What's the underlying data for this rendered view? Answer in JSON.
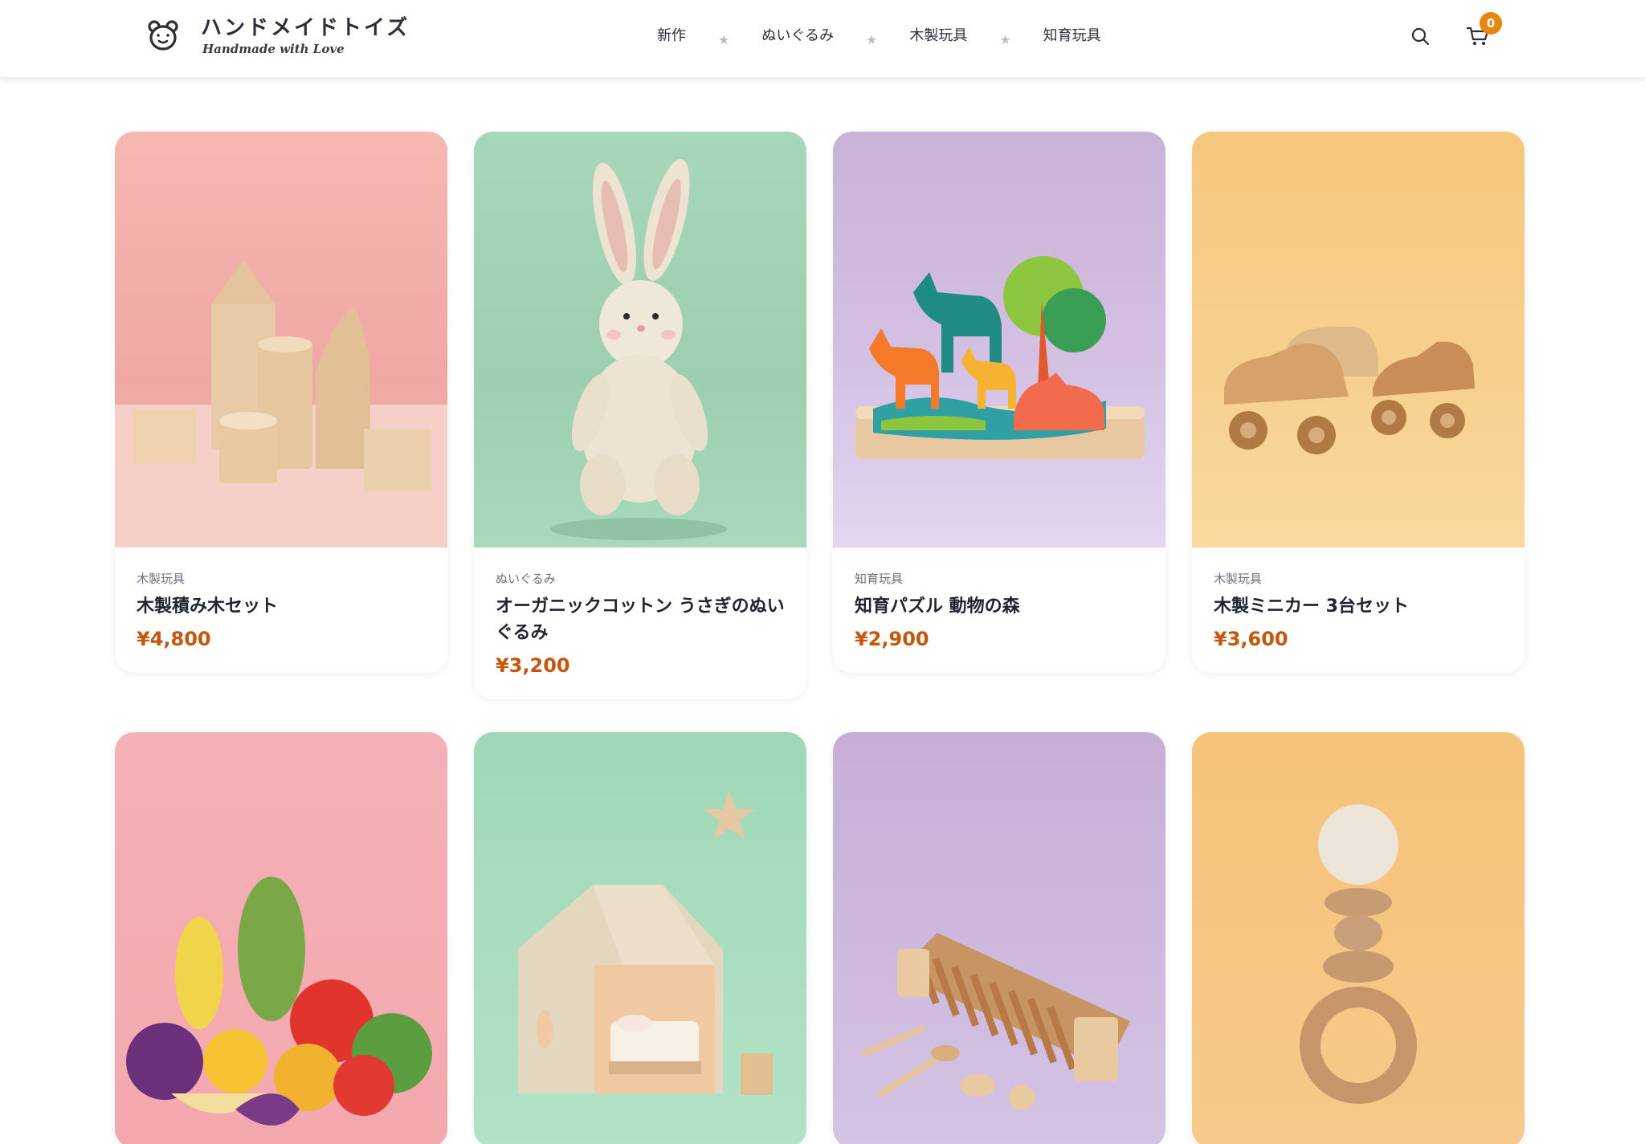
{
  "brand": {
    "title": "ハンドメイドトイズ",
    "subtitle": "Handmade with Love",
    "icon": "bear-face-icon"
  },
  "nav": {
    "items": [
      {
        "label": "新作"
      },
      {
        "label": "ぬいぐるみ"
      },
      {
        "label": "木製玩具"
      },
      {
        "label": "知育玩具"
      }
    ],
    "separator_icon": "star-icon"
  },
  "header_actions": {
    "search_icon": "search-icon",
    "cart_icon": "cart-icon",
    "cart_count": "0",
    "badge_color": "#e8860f"
  },
  "products": [
    {
      "category": "木製玩具",
      "name": "木製積み木セット",
      "price": "¥4,800",
      "image": "wooden-blocks",
      "bg": "pink"
    },
    {
      "category": "ぬいぐるみ",
      "name": "オーガニックコットン うさぎのぬいぐるみ",
      "price": "¥3,200",
      "image": "rabbit-plush",
      "bg": "green"
    },
    {
      "category": "知育玩具",
      "name": "知育パズル 動物の森",
      "price": "¥2,900",
      "image": "animal-puzzle",
      "bg": "purple"
    },
    {
      "category": "木製玩具",
      "name": "木製ミニカー 3台セット",
      "price": "¥3,600",
      "image": "wooden-cars",
      "bg": "yellow"
    },
    {
      "image": "felt-vegetables",
      "bg": "pink"
    },
    {
      "image": "play-house",
      "bg": "green"
    },
    {
      "image": "xylophone",
      "bg": "purple"
    },
    {
      "image": "rattle",
      "bg": "yellow"
    }
  ],
  "colors": {
    "price": "#c4570c",
    "text": "#1f2430",
    "category": "#6b7080"
  }
}
